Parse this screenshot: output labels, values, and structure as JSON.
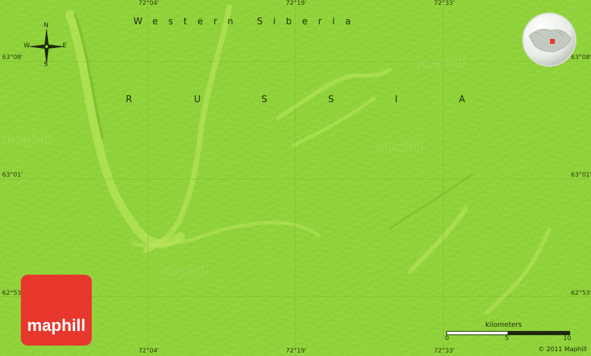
{
  "map": {
    "region_label": "Western Siberia",
    "country_label": "RUSSIA",
    "country_letters": [
      "R",
      "U",
      "S",
      "S",
      "I",
      "A"
    ],
    "colors": {
      "land": "#8fd23a",
      "ridge": "#b9e45c",
      "valley": "#76b82a",
      "logo": "#e8382e"
    },
    "coords_top": [
      "72°04'",
      "72°19'",
      "72°33'"
    ],
    "coords_bottom": [
      "72°04'",
      "72°19'",
      "72°33'"
    ],
    "coords_left": [
      "63°08'",
      "63°01'",
      "62°53'"
    ],
    "coords_right": [
      "63°08'",
      "63°01'",
      "62°53'"
    ]
  },
  "compass": {
    "n": "N",
    "s": "S",
    "e": "E",
    "w": "W"
  },
  "logo": {
    "text": "maphill"
  },
  "scale": {
    "title": "kilometers",
    "ticks": [
      "0",
      "5",
      "10"
    ]
  },
  "copyright": "© 2011 Maphill",
  "watermark": "maphill"
}
